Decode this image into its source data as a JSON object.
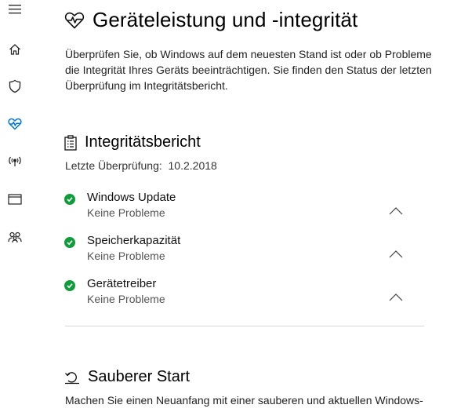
{
  "page": {
    "title": "Geräteleistung und -integrität",
    "description": "Überprüfen Sie, ob Windows auf dem neuesten Stand ist oder ob Probleme die Integrität Ihres Geräts beeinträchtigen. Sie finden den Status der letzten Überprüfung im Integritätsbericht."
  },
  "health_report": {
    "title": "Integritätsbericht",
    "last_check": "Letzte Überprüfung:  10.2.2018",
    "items": [
      {
        "name": "Windows Update",
        "status": "Keine Probleme"
      },
      {
        "name": "Speicherkapazität",
        "status": "Keine Probleme"
      },
      {
        "name": "Gerätetreiber",
        "status": "Keine Probleme"
      }
    ]
  },
  "fresh_start": {
    "title": "Sauberer Start",
    "description": "Machen Sie einen Neuanfang mit einer sauberen und aktuellen Windows-"
  },
  "icons": {
    "rail": [
      "menu-icon",
      "home-icon",
      "shield-icon",
      "heart-pulse-icon",
      "wireless-icon",
      "browser-window-icon",
      "family-icon"
    ],
    "status": "check-icon",
    "expand": "chevron-up-icon"
  },
  "colors": {
    "accent": "#0078d7",
    "ok": "#0f9d3a"
  }
}
